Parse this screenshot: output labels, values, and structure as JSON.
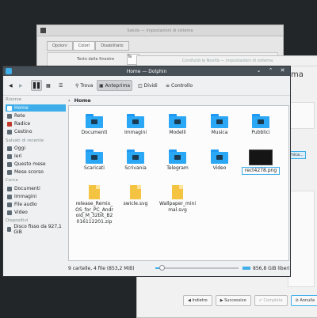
{
  "bg_window1": {
    "title": "Salute — Impostazioni di sistema",
    "tabs": [
      "Opzioni",
      "Colori",
      "Disabilitato"
    ],
    "label": "Testo delle finestre",
    "edit_value": "Te"
  },
  "bg_window2": {
    "title": "Condividi le Novità — Impostazioni di sistema",
    "heading_fragment": "ma",
    "selected_fragment": "mica...",
    "buttons": {
      "back": "Indietro",
      "next": "Successivo",
      "finish": "Completa",
      "cancel": "Annulla"
    }
  },
  "dolphin": {
    "title": "Home — Dolphin",
    "toolbar": {
      "search": "Trova",
      "preview": "Anteprima",
      "split": "Dividi",
      "control": "Controllo"
    },
    "breadcrumb": "Home",
    "sidebar": {
      "sections": [
        {
          "title": "Risorse",
          "items": [
            "Home",
            "Rete",
            "Radice",
            "Cestino"
          ]
        },
        {
          "title": "Salvati di recente",
          "items": [
            "Oggi",
            "Ieri",
            "Questo mese",
            "Mese scorso"
          ]
        },
        {
          "title": "Cerca",
          "items": [
            "Documenti",
            "Immagini",
            "File audio",
            "Video"
          ]
        },
        {
          "title": "Dispositivi",
          "items": [
            "Disco fisso da 927,1 GiB"
          ]
        }
      ]
    },
    "files": [
      {
        "name": "Documenti",
        "kind": "folder"
      },
      {
        "name": "Immagini",
        "kind": "folder"
      },
      {
        "name": "Modelli",
        "kind": "folder"
      },
      {
        "name": "Musica",
        "kind": "folder"
      },
      {
        "name": "Pubblici",
        "kind": "folder"
      },
      {
        "name": "Scaricati",
        "kind": "folder"
      },
      {
        "name": "Scrivania",
        "kind": "folder"
      },
      {
        "name": "Telegram",
        "kind": "folder"
      },
      {
        "name": "Video",
        "kind": "folder"
      },
      {
        "name": "rect4278.png",
        "kind": "image"
      },
      {
        "name": "release_Remix_OS_for_PC_Android_M_32bit_B2016112201.zip",
        "kind": "archive"
      },
      {
        "name": "swicle.svg",
        "kind": "svg"
      },
      {
        "name": "Wallpaper_minimal.svg",
        "kind": "svg"
      }
    ],
    "status": {
      "summary": "9 cartelle, 4 file (853,2 MiB)",
      "free": "856,8 GiB liberi",
      "zoom": 0.08
    },
    "colors": {
      "accent": "#3daee9",
      "folder": "#2aa7f5",
      "titlebar": "#475057"
    }
  }
}
